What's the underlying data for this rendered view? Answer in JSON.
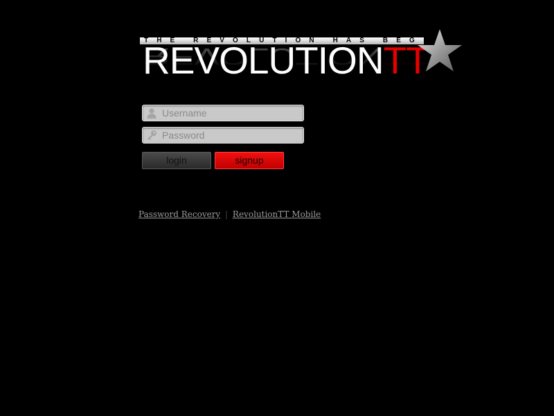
{
  "logo": {
    "tagline": "THE REVOLUTION HAS BEGUN",
    "word_main": "REVOLUTION",
    "word_accent": "TT",
    "accent_color": "#e60000"
  },
  "login_form": {
    "username_placeholder": "Username",
    "username_value": "",
    "password_placeholder": "Password",
    "password_value": "",
    "username_icon": "user-icon",
    "password_icon": "key-icon",
    "login_label": "login",
    "signup_label": "signup"
  },
  "footer_links": {
    "password_recovery": "Password Recovery",
    "separator": "|",
    "mobile": "RevolutionTT Mobile"
  },
  "colors": {
    "background": "#000000",
    "signup_red": "#e60000",
    "field_gray": "#c9c9c9"
  }
}
